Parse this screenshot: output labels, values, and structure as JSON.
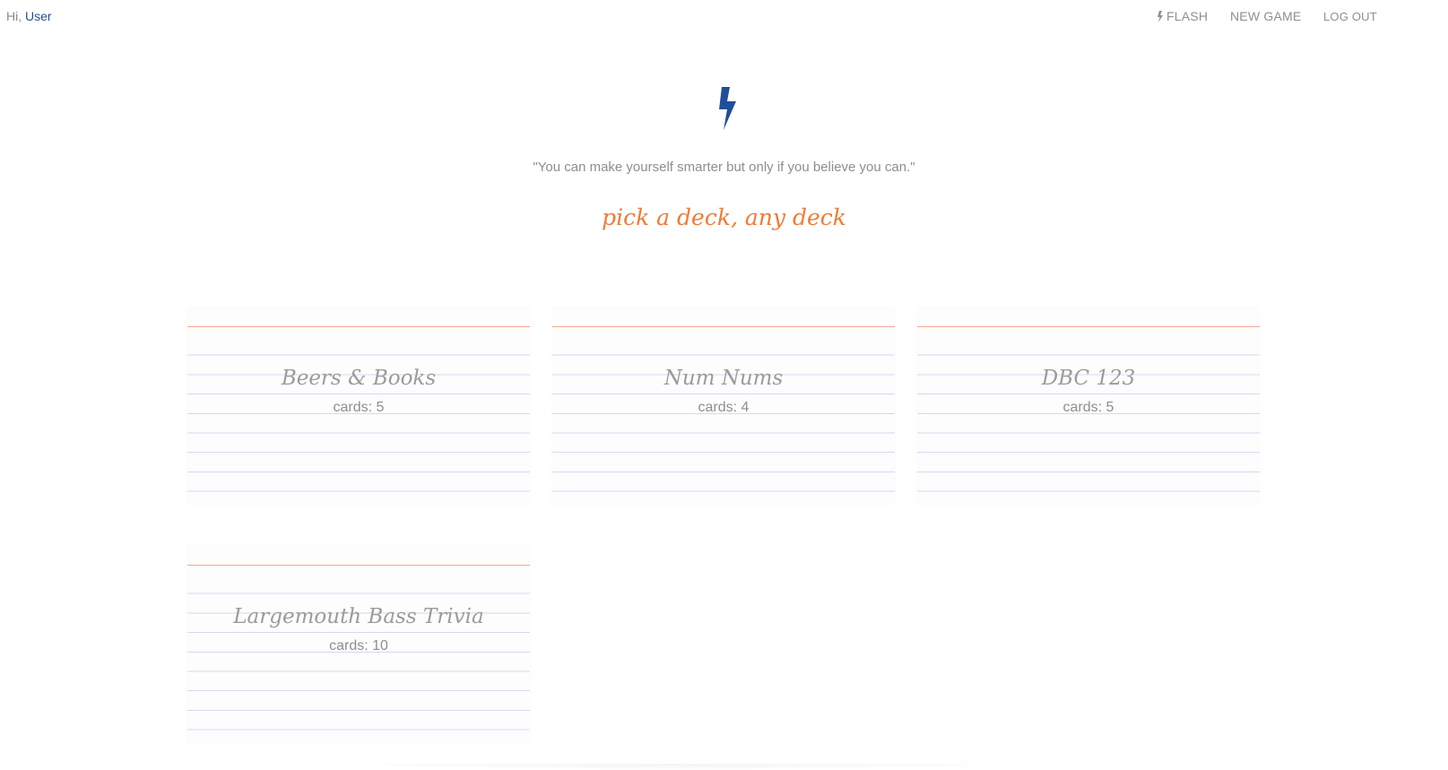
{
  "header": {
    "greeting_prefix": "Hi, ",
    "user_name": "User"
  },
  "nav": {
    "items": [
      {
        "label": "FLASH",
        "icon": "lightning-bolt-icon"
      },
      {
        "label": "NEW GAME"
      },
      {
        "label": "LOG OUT"
      }
    ]
  },
  "hero": {
    "icon": "lightning-bolt-icon",
    "quote": "\"You can make yourself smarter but only if you believe you can.\"",
    "tagline": "pick a deck, any deck"
  },
  "decks": [
    {
      "title": "Beers & Books",
      "count_label": "cards: 5"
    },
    {
      "title": "Num Nums",
      "count_label": "cards: 4"
    },
    {
      "title": "DBC 123",
      "count_label": "cards: 5"
    },
    {
      "title": "Largemouth Bass Trivia",
      "count_label": "cards: 10"
    }
  ],
  "colors": {
    "brand_blue": "#1f4f9a",
    "accent_orange": "#f07a36",
    "card_red_line": "#f0a792",
    "card_blue_line": "#d6d8f0",
    "muted_text": "#8e8e8e"
  }
}
